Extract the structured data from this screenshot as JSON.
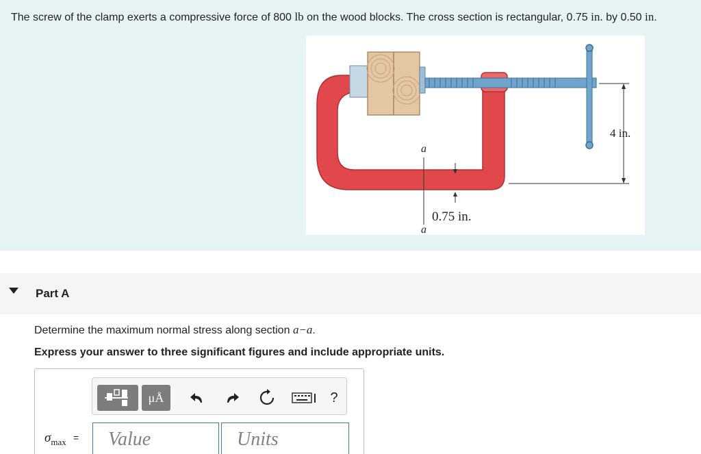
{
  "problem": {
    "text_before_lb": "The screw of the clamp exerts a compressive force of 800",
    "unit_lb": "lb",
    "text_mid": "on the wood blocks. The cross section is rectangular, 0.75",
    "unit_in_1": "in.",
    "text_by": "by 0.50",
    "unit_in_2": "in",
    "text_end": "."
  },
  "figure": {
    "label_a_top": "a",
    "label_a_bottom": "a",
    "dim_width": "0.75 in.",
    "dim_height": "4 in."
  },
  "part": {
    "title": "Part A",
    "question_text": "Determine the maximum normal stress along section",
    "question_section": "a−a",
    "question_end": ".",
    "instruction": "Express your answer to three significant figures and include appropriate units."
  },
  "answer": {
    "sigma_symbol": "σ",
    "sigma_sub": "max",
    "equals": "=",
    "value_placeholder": "Value",
    "units_placeholder": "Units",
    "units_button_label": "μÅ",
    "help_label": "?"
  },
  "colors": {
    "problem_bg": "#e7f4f5",
    "clamp_red": "#e0484b",
    "screw_blue": "#6fa5cc",
    "wood": "#e4c7a2",
    "input_border": "#3d7fa6"
  }
}
